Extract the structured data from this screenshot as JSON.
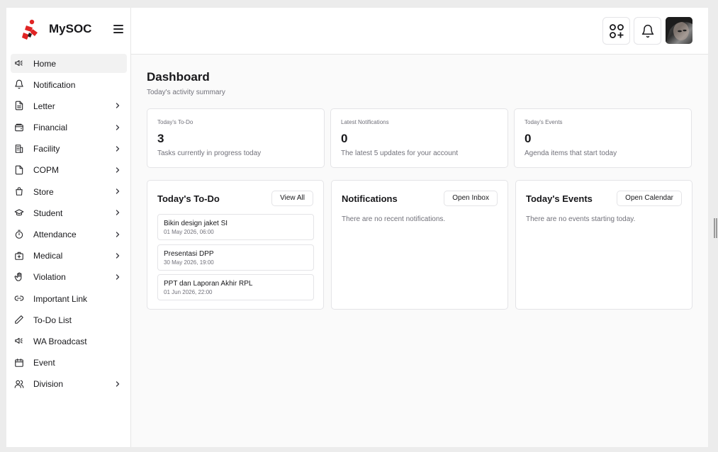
{
  "brand": {
    "name": "MySOC"
  },
  "sidebar": {
    "items": [
      {
        "label": "Home",
        "icon": "megaphone-icon",
        "active": true,
        "chevron": false
      },
      {
        "label": "Notification",
        "icon": "bell-icon",
        "active": false,
        "chevron": false
      },
      {
        "label": "Letter",
        "icon": "file-text-icon",
        "active": false,
        "chevron": true
      },
      {
        "label": "Financial",
        "icon": "wallet-icon",
        "active": false,
        "chevron": true
      },
      {
        "label": "Facility",
        "icon": "building-icon",
        "active": false,
        "chevron": true
      },
      {
        "label": "COPM",
        "icon": "file-icon",
        "active": false,
        "chevron": true
      },
      {
        "label": "Store",
        "icon": "shopping-bag-icon",
        "active": false,
        "chevron": true
      },
      {
        "label": "Student",
        "icon": "graduation-cap-icon",
        "active": false,
        "chevron": true
      },
      {
        "label": "Attendance",
        "icon": "stopwatch-icon",
        "active": false,
        "chevron": true
      },
      {
        "label": "Medical",
        "icon": "medical-kit-icon",
        "active": false,
        "chevron": true
      },
      {
        "label": "Violation",
        "icon": "hand-icon",
        "active": false,
        "chevron": true
      },
      {
        "label": "Important Link",
        "icon": "link-icon",
        "active": false,
        "chevron": false
      },
      {
        "label": "To-Do List",
        "icon": "pencil-icon",
        "active": false,
        "chevron": false
      },
      {
        "label": "WA Broadcast",
        "icon": "megaphone-icon",
        "active": false,
        "chevron": false
      },
      {
        "label": "Event",
        "icon": "calendar-icon",
        "active": false,
        "chevron": false
      },
      {
        "label": "Division",
        "icon": "users-icon",
        "active": false,
        "chevron": true
      }
    ]
  },
  "header": {
    "apps_icon": "apps-add-icon",
    "bell_icon": "bell-icon"
  },
  "page": {
    "title": "Dashboard",
    "subtitle": "Today's activity summary"
  },
  "stats": [
    {
      "label": "Today's To-Do",
      "value": "3",
      "desc": "Tasks currently in progress today"
    },
    {
      "label": "Latest Notifications",
      "value": "0",
      "desc": "The latest 5 updates for your account"
    },
    {
      "label": "Today's Events",
      "value": "0",
      "desc": "Agenda items that start today"
    }
  ],
  "panels": {
    "todo": {
      "title": "Today's To-Do",
      "button": "View All",
      "items": [
        {
          "title": "Bikin design jaket SI",
          "date": "01 May 2026, 06:00"
        },
        {
          "title": "Presentasi DPP",
          "date": "30 May 2026, 19:00"
        },
        {
          "title": "PPT dan Laporan Akhir RPL",
          "date": "01 Jun 2026, 22:00"
        }
      ]
    },
    "notifications": {
      "title": "Notifications",
      "button": "Open Inbox",
      "empty": "There are no recent notifications."
    },
    "events": {
      "title": "Today's Events",
      "button": "Open Calendar",
      "empty": "There are no events starting today."
    }
  },
  "colors": {
    "accent": "#e02424",
    "border": "#e4e4e7",
    "muted": "#71717a"
  }
}
